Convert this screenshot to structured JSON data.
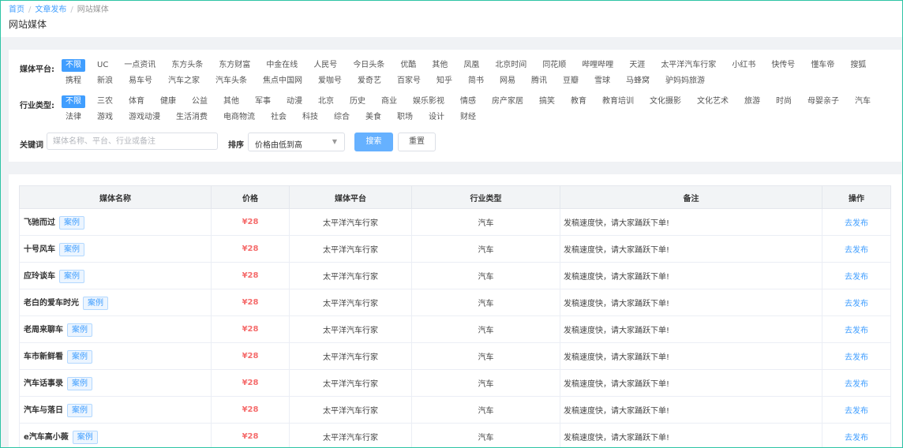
{
  "breadcrumb": {
    "items": [
      "首页",
      "文章发布",
      "网站媒体"
    ]
  },
  "page_title": "网站媒体",
  "filters": {
    "platform": {
      "label": "媒体平台:",
      "options": [
        "不限",
        "UC",
        "一点资讯",
        "东方头条",
        "东方财富",
        "中金在线",
        "人民号",
        "今日头条",
        "优酷",
        "其他",
        "凤凰",
        "北京时间",
        "同花顺",
        "哔哩哔哩",
        "天涯",
        "太平洋汽车行家",
        "小红书",
        "快传号",
        "懂车帝",
        "搜狐",
        "携程",
        "新浪",
        "易车号",
        "汽车之家",
        "汽车头条",
        "焦点中国网",
        "爱咖号",
        "爱奇艺",
        "百家号",
        "知乎",
        "简书",
        "网易",
        "腾讯",
        "豆瓣",
        "雪球",
        "马蜂窝",
        "驴妈妈旅游"
      ],
      "selected": "不限"
    },
    "industry": {
      "label": "行业类型:",
      "options": [
        "不限",
        "三农",
        "体育",
        "健康",
        "公益",
        "其他",
        "军事",
        "动漫",
        "北京",
        "历史",
        "商业",
        "娱乐影视",
        "情感",
        "房产家居",
        "搞笑",
        "教育",
        "教育培训",
        "文化摄影",
        "文化艺术",
        "旅游",
        "时尚",
        "母婴亲子",
        "汽车",
        "法律",
        "游戏",
        "游戏动漫",
        "生活消费",
        "电商物流",
        "社会",
        "科技",
        "综合",
        "美食",
        "职场",
        "设计",
        "财经"
      ],
      "selected": "不限"
    },
    "keyword": {
      "label": "关键词",
      "placeholder": "媒体名称、平台、行业或备注",
      "value": ""
    },
    "sort": {
      "label": "排序",
      "value": "价格由低到高"
    },
    "search_button": "搜索",
    "reset_button": "重置"
  },
  "table": {
    "headers": [
      "媒体名称",
      "价格",
      "媒体平台",
      "行业类型",
      "备注",
      "操作"
    ],
    "case_label": "案例",
    "action_label": "去发布",
    "rows": [
      {
        "name": "飞驰而过",
        "price": "¥28",
        "platform": "太平洋汽车行家",
        "industry": "汽车",
        "note": "发稿速度快，请大家踊跃下单!"
      },
      {
        "name": "十号风车",
        "price": "¥28",
        "platform": "太平洋汽车行家",
        "industry": "汽车",
        "note": "发稿速度快，请大家踊跃下单!"
      },
      {
        "name": "应玲谈车",
        "price": "¥28",
        "platform": "太平洋汽车行家",
        "industry": "汽车",
        "note": "发稿速度快，请大家踊跃下单!"
      },
      {
        "name": "老白的爱车时光",
        "price": "¥28",
        "platform": "太平洋汽车行家",
        "industry": "汽车",
        "note": "发稿速度快，请大家踊跃下单!"
      },
      {
        "name": "老周来聊车",
        "price": "¥28",
        "platform": "太平洋汽车行家",
        "industry": "汽车",
        "note": "发稿速度快，请大家踊跃下单!"
      },
      {
        "name": "车市新鲜看",
        "price": "¥28",
        "platform": "太平洋汽车行家",
        "industry": "汽车",
        "note": "发稿速度快，请大家踊跃下单!"
      },
      {
        "name": "汽车话事录",
        "price": "¥28",
        "platform": "太平洋汽车行家",
        "industry": "汽车",
        "note": "发稿速度快，请大家踊跃下单!"
      },
      {
        "name": "汽车与落日",
        "price": "¥28",
        "platform": "太平洋汽车行家",
        "industry": "汽车",
        "note": "发稿速度快，请大家踊跃下单!"
      },
      {
        "name": "e汽车高小薇",
        "price": "¥28",
        "platform": "太平洋汽车行家",
        "industry": "汽车",
        "note": "发稿速度快，请大家踊跃下单!"
      }
    ]
  },
  "colors": {
    "accent": "#409eff",
    "price": "#f56c6c",
    "frame_border": "#2ec4a5"
  },
  "icons": {
    "sort_caret": "chevron-down-icon"
  }
}
